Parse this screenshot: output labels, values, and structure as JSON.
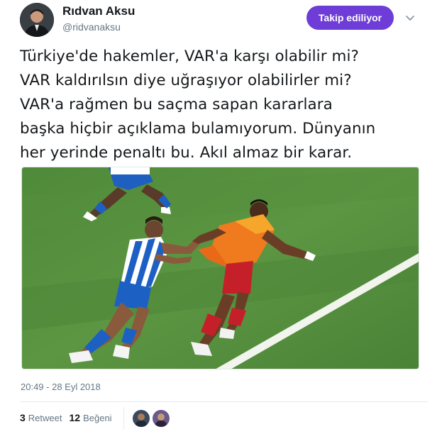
{
  "user": {
    "display_name": "Rıdvan Aksu",
    "handle": "@ridvanaksu",
    "avatar_icon": "profile-photo"
  },
  "follow_button": {
    "label": "Takip ediliyor",
    "color": "#6e3cd6"
  },
  "menu_icon": "chevron-down-icon",
  "tweet": {
    "lines": [
      "Türkiye'de hakemler, VAR'a karşı olabilir mi?",
      "VAR kaldırılsın diye uğraşıyor olabilirler mi?",
      "VAR'a rağmen bu saçma sapan kararlara",
      "başka hiçbir açıklama bulamıyorum. Dünyanın",
      "her yerinde penaltı bu. Akıl almaz bir karar."
    ]
  },
  "media": {
    "icon": "football-match-photo"
  },
  "timestamp": "20:49 - 28 Eyl 2018",
  "stats": {
    "retweets_count": "3",
    "retweets_label": "Retweet",
    "likes_count": "12",
    "likes_label": "Beğeni"
  },
  "colors": {
    "text": "#14171a",
    "secondary": "#657786",
    "accent": "#6e3cd6"
  }
}
